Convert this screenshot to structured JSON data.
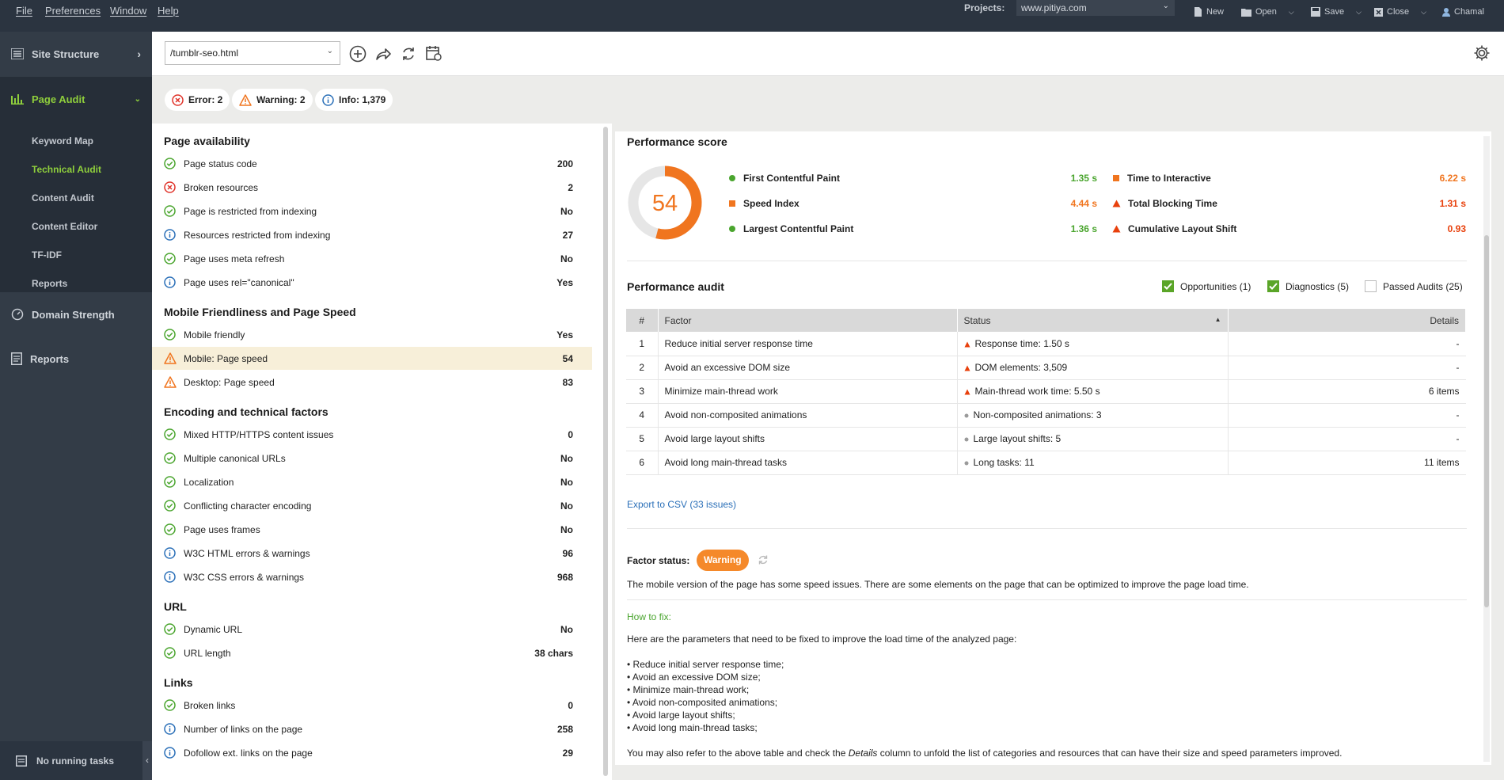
{
  "menubar": {
    "items": [
      "File",
      "Preferences",
      "Window",
      "Help"
    ],
    "projects_label": "Projects:",
    "project_value": "www.pitiya.com",
    "buttons": {
      "new": "New",
      "open": "Open",
      "save": "Save",
      "close": "Close",
      "user": "Chamal"
    }
  },
  "sidebar": {
    "site_structure": "Site Structure",
    "page_audit": "Page Audit",
    "sub_items": [
      "Keyword Map",
      "Technical Audit",
      "Content Audit",
      "Content Editor",
      "TF-IDF",
      "Reports"
    ],
    "domain_strength": "Domain Strength",
    "reports": "Reports",
    "tasks": "No running tasks"
  },
  "toolbar": {
    "url_value": "/tumblr-seo.html"
  },
  "issues": {
    "error": "Error: 2",
    "warning": "Warning: 2",
    "info": "Info: 1,379"
  },
  "factors": {
    "sections": [
      {
        "title": "Page availability",
        "rows": [
          {
            "status": "ok",
            "label": "Page status code",
            "value": "200"
          },
          {
            "status": "error",
            "label": "Broken resources",
            "value": "2"
          },
          {
            "status": "ok",
            "label": "Page is restricted from indexing",
            "value": "No"
          },
          {
            "status": "info",
            "label": "Resources restricted from indexing",
            "value": "27"
          },
          {
            "status": "ok",
            "label": "Page uses meta refresh",
            "value": "No"
          },
          {
            "status": "info",
            "label": "Page uses rel=\"canonical\"",
            "value": "Yes"
          }
        ]
      },
      {
        "title": "Mobile Friendliness and Page Speed",
        "rows": [
          {
            "status": "ok",
            "label": "Mobile friendly",
            "value": "Yes"
          },
          {
            "status": "warn",
            "label": "Mobile: Page speed",
            "value": "54",
            "selected": true
          },
          {
            "status": "warn",
            "label": "Desktop: Page speed",
            "value": "83"
          }
        ]
      },
      {
        "title": "Encoding and technical factors",
        "rows": [
          {
            "status": "ok",
            "label": "Mixed HTTP/HTTPS content issues",
            "value": "0"
          },
          {
            "status": "ok",
            "label": "Multiple canonical URLs",
            "value": "No"
          },
          {
            "status": "ok",
            "label": "Localization",
            "value": "No"
          },
          {
            "status": "ok",
            "label": "Conflicting character encoding",
            "value": "No"
          },
          {
            "status": "ok",
            "label": "Page uses frames",
            "value": "No"
          },
          {
            "status": "info",
            "label": "W3C HTML errors & warnings",
            "value": "96"
          },
          {
            "status": "info",
            "label": "W3C CSS errors & warnings",
            "value": "968"
          }
        ]
      },
      {
        "title": "URL",
        "rows": [
          {
            "status": "ok",
            "label": "Dynamic URL",
            "value": "No"
          },
          {
            "status": "ok",
            "label": "URL length",
            "value": "38 chars"
          }
        ]
      },
      {
        "title": "Links",
        "rows": [
          {
            "status": "ok",
            "label": "Broken links",
            "value": "0"
          },
          {
            "status": "info",
            "label": "Number of links on the page",
            "value": "258"
          },
          {
            "status": "info",
            "label": "Dofollow ext. links on the page",
            "value": "29"
          }
        ]
      }
    ]
  },
  "performance": {
    "title": "Performance score",
    "score": "54",
    "score_fraction": 0.54,
    "metrics": [
      {
        "shape": "circle",
        "color": "#4aa52e",
        "label": "First Contentful Paint",
        "value": "1.35 s",
        "vclass": "green"
      },
      {
        "shape": "square",
        "color": "#f0751f",
        "label": "Speed Index",
        "value": "4.44 s",
        "vclass": "orange"
      },
      {
        "shape": "circle",
        "color": "#4aa52e",
        "label": "Largest Contentful Paint",
        "value": "1.36 s",
        "vclass": "green"
      },
      {
        "shape": "square",
        "color": "#f0751f",
        "label": "Time to Interactive",
        "value": "6.22 s",
        "vclass": "orange"
      },
      {
        "shape": "triangle",
        "color": "#e8400c",
        "label": "Total Blocking Time",
        "value": "1.31 s",
        "vclass": "red"
      },
      {
        "shape": "triangle",
        "color": "#e8400c",
        "label": "Cumulative Layout Shift",
        "value": "0.93",
        "vclass": "red"
      }
    ]
  },
  "audit": {
    "title": "Performance audit",
    "filters": [
      {
        "label": "Opportunities (1)",
        "checked": true
      },
      {
        "label": "Diagnostics (5)",
        "checked": true
      },
      {
        "label": "Passed Audits (25)",
        "checked": false
      }
    ],
    "columns": [
      "#",
      "Factor",
      "Status",
      "Details"
    ],
    "rows": [
      {
        "n": "1",
        "factor": "Reduce initial server response time",
        "marker": "tri",
        "status": "Response time: 1.50 s",
        "details": "-"
      },
      {
        "n": "2",
        "factor": "Avoid an excessive DOM size",
        "marker": "tri",
        "status": "DOM elements: 3,509",
        "details": "-"
      },
      {
        "n": "3",
        "factor": "Minimize main-thread work",
        "marker": "tri",
        "status": "Main-thread work time: 5.50 s",
        "details": "6 items"
      },
      {
        "n": "4",
        "factor": "Avoid non-composited animations",
        "marker": "dot",
        "status": "Non-composited animations: 3",
        "details": "-"
      },
      {
        "n": "5",
        "factor": "Avoid large layout shifts",
        "marker": "dot",
        "status": "Large layout shifts: 5",
        "details": "-"
      },
      {
        "n": "6",
        "factor": "Avoid long main-thread tasks",
        "marker": "dot",
        "status": "Long tasks: 11",
        "details": "11 items"
      }
    ],
    "export_link": "Export to CSV (33 issues)"
  },
  "factor_status": {
    "label": "Factor status:",
    "badge": "Warning",
    "description": "The mobile version of the page has some speed issues. There are some elements on the page that can be optimized to improve the page load time.",
    "how_to_fix": "How to fix:",
    "fix_intro": "Here are the parameters that need to be fixed to improve the load time of the analyzed page:",
    "fix_items": [
      "Reduce initial server response time;",
      "Avoid an excessive DOM size;",
      "Minimize main-thread work;",
      "Avoid non-composited animations;",
      "Avoid large layout shifts;",
      "Avoid long main-thread tasks;"
    ],
    "footer_before": "You may also refer to the above table and check the ",
    "footer_em": "Details",
    "footer_after": " column to unfold the list of categories and resources that can have their size and speed parameters improved."
  }
}
